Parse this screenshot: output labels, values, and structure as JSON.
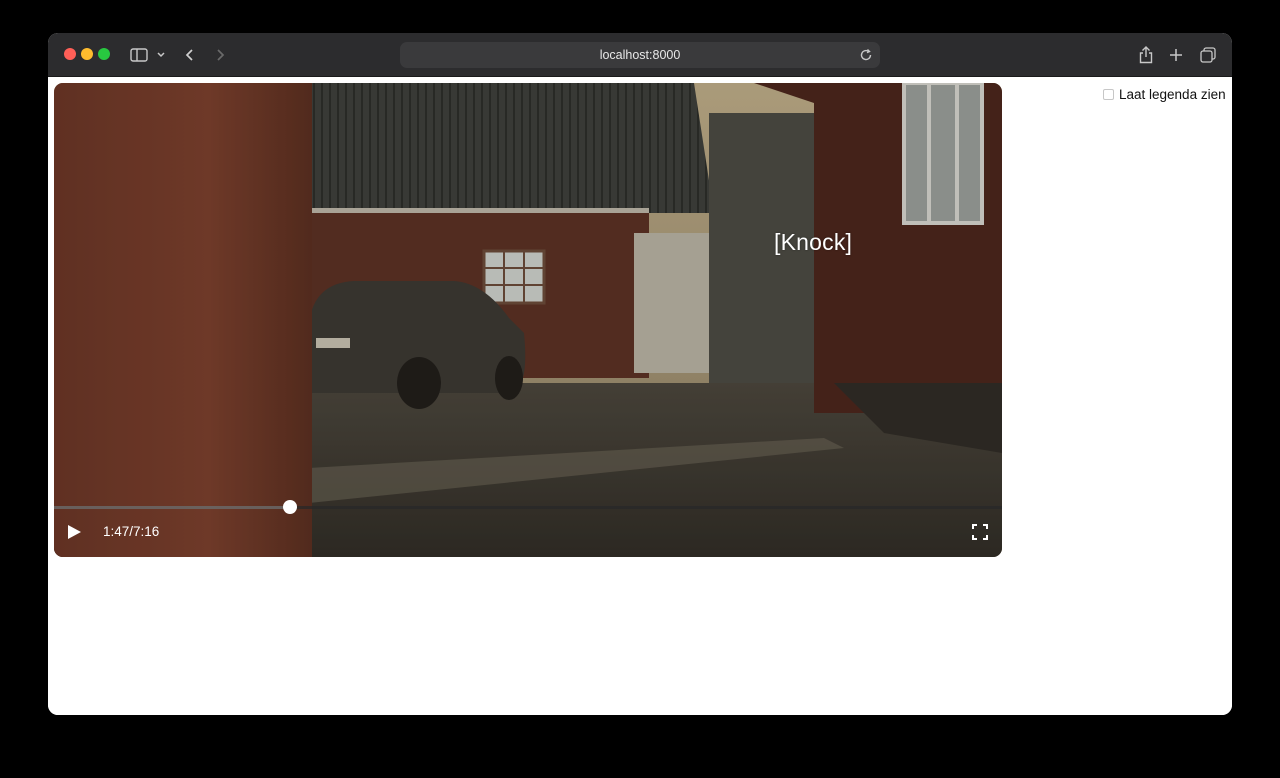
{
  "browser": {
    "url": "localhost:8000",
    "icons": [
      "sidebar-icon",
      "chevron-down-icon",
      "back-icon",
      "forward-icon",
      "reload-icon",
      "share-icon",
      "new-tab-icon",
      "tabs-overview-icon"
    ]
  },
  "video": {
    "caption": "[Knock]",
    "time_display": "1:47/7:16",
    "progress_fraction": 0.249,
    "controls": {
      "play_icon": "play-icon",
      "fullscreen_icon": "fullscreen-icon"
    }
  },
  "legend_toggle": {
    "label": "Laat legenda zien",
    "checked": false
  }
}
